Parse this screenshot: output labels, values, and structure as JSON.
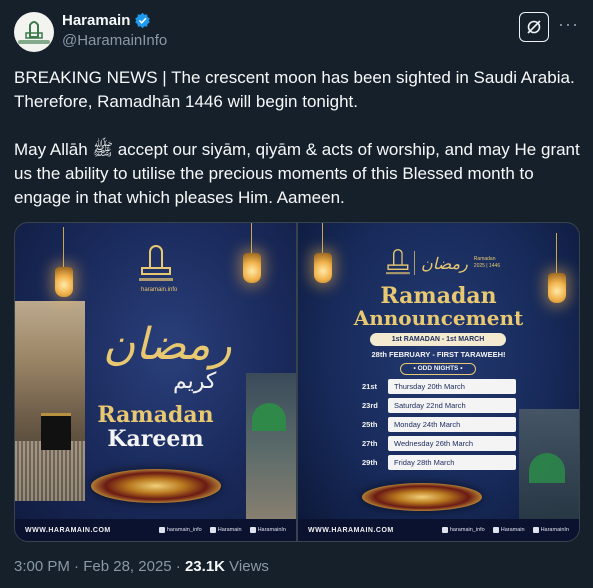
{
  "author": {
    "display_name": "Haramain",
    "handle": "@HaramainInfo",
    "avatar_icon": "haramain-logo",
    "verified_color": "#1d9bf0"
  },
  "actions": {
    "grok_icon": "grok-icon",
    "more_label": "···"
  },
  "tweet": {
    "text": "BREAKING NEWS | The crescent moon has been sighted in Saudi Arabia. Therefore, Ramadhān 1446 will begin tonight.\n\nMay Allāh ﷺ accept our siyām, qiyām & acts of worship, and may He grant us the ability to utilise the precious moments of this Blessed month to engage in that which pleases Him. Aameen."
  },
  "media": {
    "left_poster": {
      "brand_small": "haramain.info",
      "script_main": "رمضان",
      "script_sub": "كريم",
      "title_line1": "Ramadan",
      "title_line2": "Kareem",
      "footer_url": "WWW.HARAMAIN.COM",
      "social_1": "haramain_info",
      "social_2": "Haramain",
      "social_3": "HaramainIn"
    },
    "right_poster": {
      "header_script": "رمضان",
      "header_meta_1": "Ramadan",
      "header_meta_2": "2025 | 1446",
      "title_line1": "Ramadan",
      "title_line2": "Announcement",
      "date_pill": "1st RAMADAN - 1st MARCH",
      "taraweeh": "28th FEBRUARY - FIRST TARAWEEH!",
      "odd_nights": "• ODD NIGHTS •",
      "nights": [
        {
          "num": "21st",
          "label": "Thursday 20th March"
        },
        {
          "num": "23rd",
          "label": "Saturday 22nd March"
        },
        {
          "num": "25th",
          "label": "Monday 24th March"
        },
        {
          "num": "27th",
          "label": "Wednesday 26th March"
        },
        {
          "num": "29th",
          "label": "Friday 28th March"
        }
      ],
      "footer_url": "WWW.HARAMAIN.COM",
      "social_1": "haramain_info",
      "social_2": "Haramain",
      "social_3": "HaramainIn"
    }
  },
  "meta": {
    "time": "3:00 PM",
    "separator": "·",
    "date": "Feb 28, 2025",
    "views_count": "23.1K",
    "views_label": "Views"
  },
  "colors": {
    "background": "#15202b",
    "gold": "#e8c870",
    "poster_navy": "#1a2a5c"
  }
}
